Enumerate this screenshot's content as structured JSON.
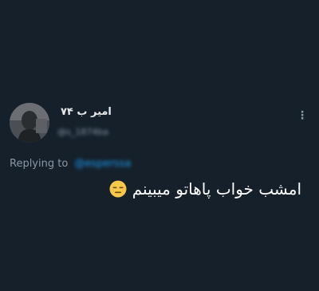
{
  "tweet": {
    "display_name": "امیر ب ۷۴",
    "handle": "@s_1874ba",
    "more_icon": "more-vertical-icon",
    "more_glyph": "⋮",
    "replying_label": "Replying to",
    "replying_handle": "@esperssa",
    "text": "امشب خواب پاهاتو میبینم",
    "emoji_icon": "expressionless-face-icon",
    "colors": {
      "background": "#15202b",
      "text": "#ffffff",
      "secondary": "#8b98a5",
      "accent": "#1d9bf0"
    }
  }
}
